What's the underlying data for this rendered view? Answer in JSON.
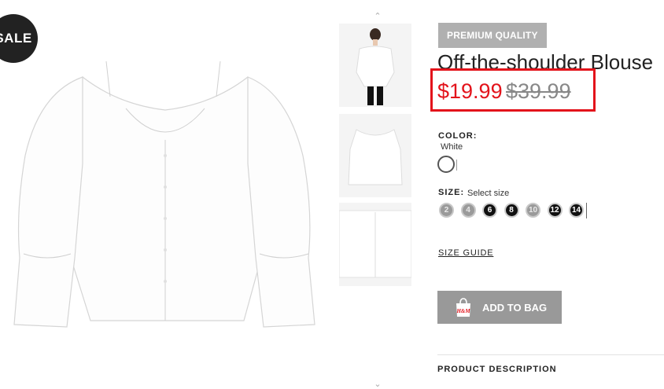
{
  "badge": {
    "sale": "SALE"
  },
  "thumbnails": {
    "up_arrow": "⌃",
    "down_arrow": "⌄"
  },
  "product": {
    "tag": "PREMIUM QUALITY",
    "title": "Off-the-shoulder Blouse",
    "price_sale": "$19.99",
    "price_original": "$39.99",
    "color_label": "COLOR:",
    "color_value": "White",
    "size_label": "SIZE:",
    "size_hint": "Select size",
    "sizes": [
      {
        "label": "2",
        "available": false
      },
      {
        "label": "4",
        "available": false
      },
      {
        "label": "6",
        "available": true
      },
      {
        "label": "8",
        "available": true
      },
      {
        "label": "10",
        "available": false
      },
      {
        "label": "12",
        "available": true
      },
      {
        "label": "14",
        "available": true
      }
    ],
    "size_guide": "SIZE GUIDE",
    "add_to_bag": "ADD TO BAG",
    "bag_brand": "H&M",
    "description_heading": "PRODUCT DESCRIPTION"
  },
  "colors": {
    "highlight": "#e3131b",
    "tag_bg": "#b0b0b0",
    "button_bg": "#999999"
  },
  "icons": {
    "bag": "shopping-bag-icon",
    "up": "chevron-up-icon",
    "down": "chevron-down-icon"
  }
}
